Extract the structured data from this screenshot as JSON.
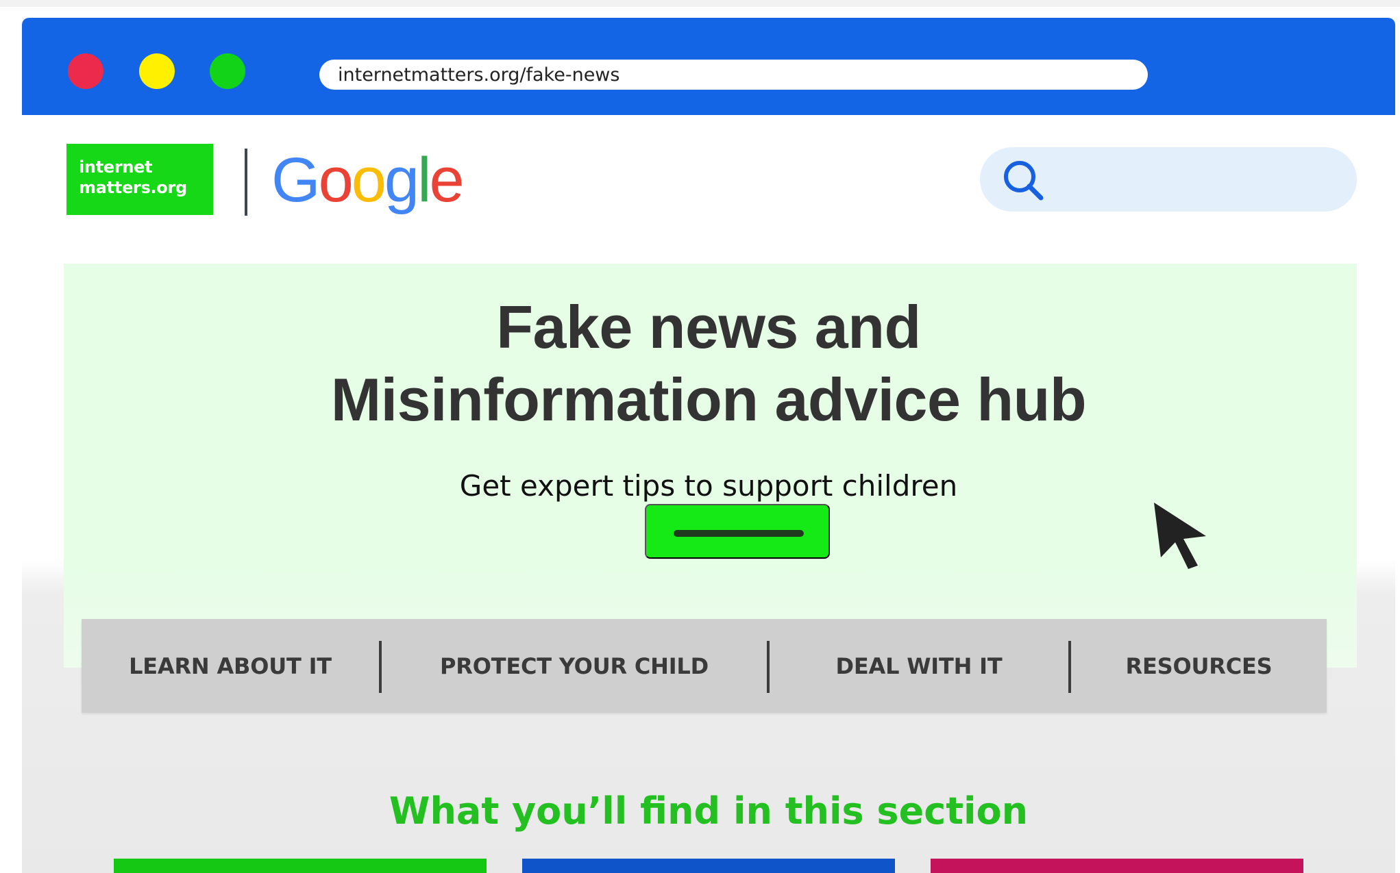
{
  "window": {
    "controls": {
      "red": "#EC2A4B",
      "yellow": "#FFF000",
      "green": "#13D319"
    },
    "address_bar": {
      "url": "internetmatters.org/fake-news"
    },
    "accent": "#1464E6"
  },
  "header": {
    "brand_logo": {
      "line1": "internet",
      "line2": "matters.org",
      "background": "#16D816"
    },
    "partner_logo": {
      "text": "Google",
      "letters": [
        "G",
        "o",
        "o",
        "g",
        "l",
        "e"
      ],
      "colors": [
        "#4285F4",
        "#EA4335",
        "#FBBC05",
        "#4285F4",
        "#34A853",
        "#EA4335"
      ]
    },
    "search": {
      "icon": "search-icon",
      "background": "#E4EFFC"
    }
  },
  "hero": {
    "title_line1": "Fake news and",
    "title_line2": "Misinformation advice hub",
    "subtitle": "Get expert tips to support children",
    "button_icon": "dash-icon",
    "background": "#E6FDE6"
  },
  "navigation": {
    "items": [
      {
        "label": "LEARN ABOUT IT"
      },
      {
        "label": "PROTECT YOUR CHILD"
      },
      {
        "label": "DEAL WITH IT"
      },
      {
        "label": "RESOURCES"
      }
    ],
    "background": "#CFCFCF"
  },
  "content": {
    "section_heading": "What you’ll find in this section",
    "cards": [
      {
        "color": "#14C814"
      },
      {
        "color": "#0F54C9"
      },
      {
        "color": "#C5135B"
      }
    ]
  },
  "overlay": {
    "cursor_icon": "mouse-pointer-icon"
  }
}
